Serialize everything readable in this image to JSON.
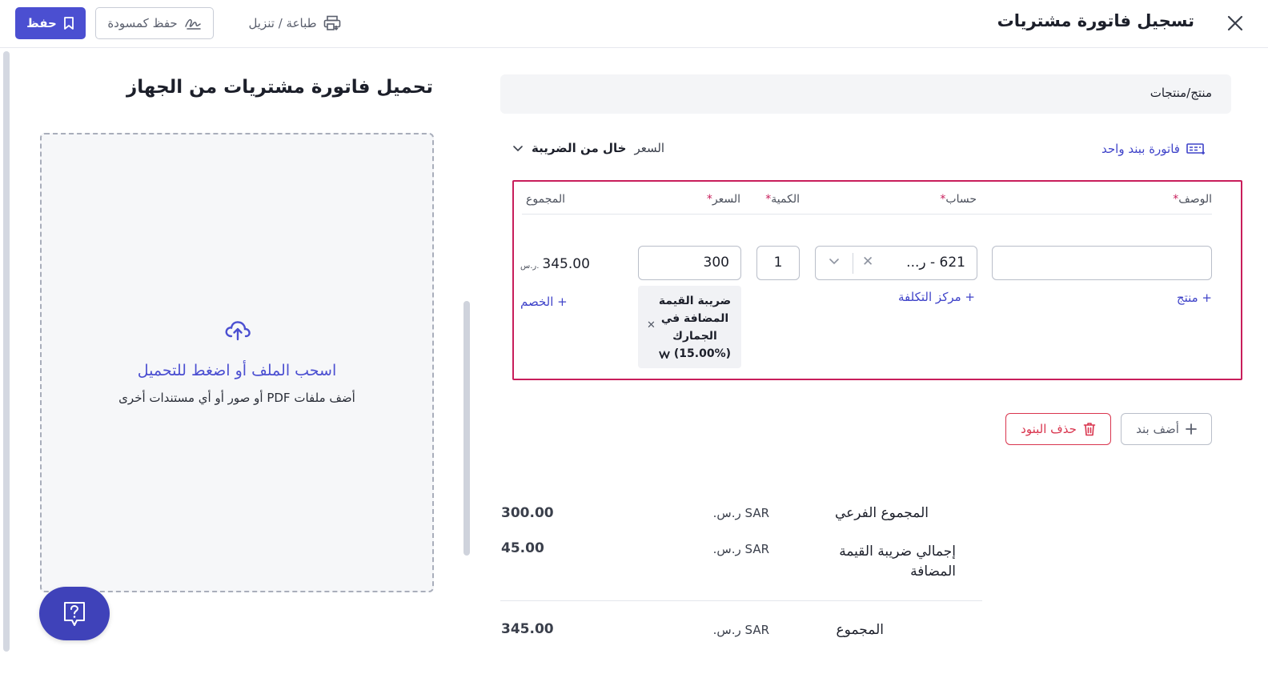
{
  "header": {
    "title": "تسجيل فاتورة مشتريات",
    "save_label": "حفظ",
    "draft_label": "حفظ كمسودة",
    "print_label": "طباعة / تنزيل"
  },
  "upload": {
    "title": "تحميل فاتورة مشتريات من الجهاز",
    "main_text": "اسحب الملف أو اضغط للتحميل",
    "sub_text": "أضف ملفات PDF أو صور أو أي مستندات أخرى"
  },
  "products": {
    "section_title": "منتج/منتجات",
    "single_invoice_label": "فاتورة ببند واحد",
    "price_mode_prefix": "السعر",
    "price_mode_value": "خال من الضريبة"
  },
  "items_table": {
    "columns": {
      "description": "الوصف",
      "account": "حساب",
      "quantity": "الكمية",
      "price": "السعر",
      "total": "المجموع",
      "required_mark": "*"
    },
    "row": {
      "description": "",
      "account": "621 - ر...",
      "quantity": "1",
      "price": "300",
      "total": "345.00",
      "total_currency": "ر.س.",
      "tax_chip_text": "ضريبة القيمة المضافة في الجمارك",
      "tax_chip_rate": "(15.00%)"
    },
    "links": {
      "add_product": "+ منتج",
      "cost_center": "+ مركز التكلفة",
      "discount": "+ الخصم"
    }
  },
  "actions": {
    "delete_items": "حذف البنود",
    "add_item": "أضف بند"
  },
  "summary": {
    "rows": [
      {
        "label": "المجموع الفرعي",
        "currency": "SAR ر.س.",
        "value": "300.00"
      },
      {
        "label": "إجمالي ضريبة القيمة المضافة",
        "currency": "SAR ر.س.",
        "value": "45.00"
      },
      {
        "label": "المجموع",
        "currency": "SAR ر.س.",
        "value": "345.00"
      }
    ]
  },
  "colors": {
    "brand": "#4b4fd1",
    "highlight_border": "#c81e5b",
    "danger": "#d9354e",
    "link": "#3f43c9"
  }
}
